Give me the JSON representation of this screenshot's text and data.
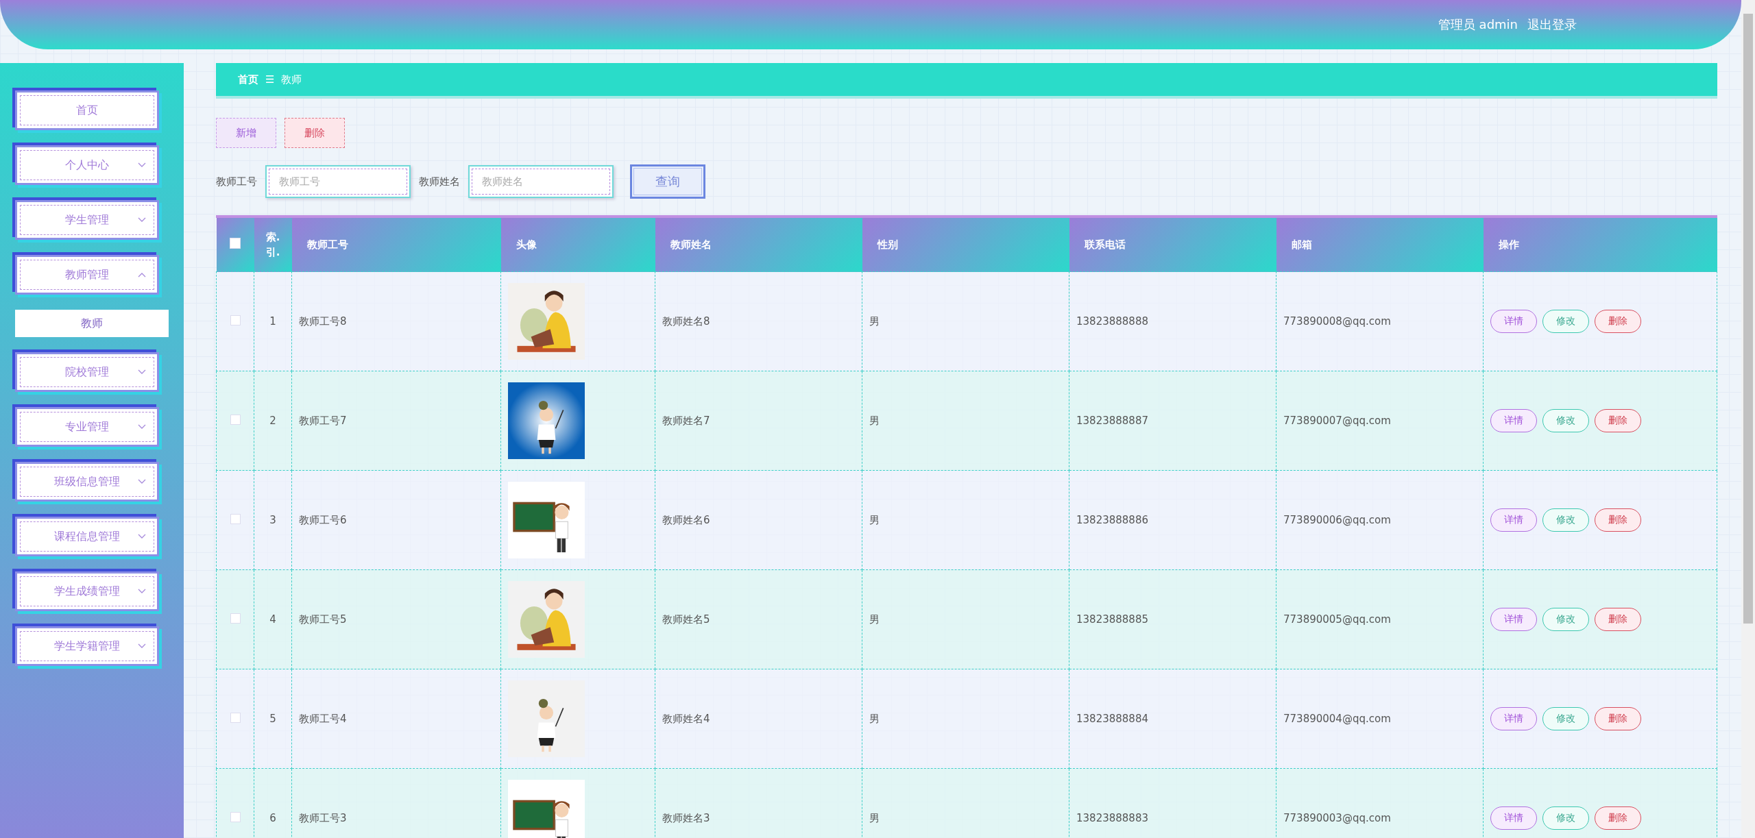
{
  "header": {
    "user_label": "管理员 admin",
    "logout": "退出登录"
  },
  "sidebar": {
    "items": [
      {
        "label": "首页",
        "kind": "link"
      },
      {
        "label": "个人中心",
        "kind": "menu",
        "expanded": false
      },
      {
        "label": "学生管理",
        "kind": "menu",
        "expanded": false
      },
      {
        "label": "教师管理",
        "kind": "menu",
        "expanded": true,
        "children": [
          {
            "label": "教师",
            "selected": true
          }
        ]
      },
      {
        "label": "院校管理",
        "kind": "menu",
        "expanded": false
      },
      {
        "label": "专业管理",
        "kind": "menu",
        "expanded": false
      },
      {
        "label": "班级信息管理",
        "kind": "menu",
        "expanded": false
      },
      {
        "label": "课程信息管理",
        "kind": "menu",
        "expanded": false
      },
      {
        "label": "学生成绩管理",
        "kind": "menu",
        "expanded": false
      },
      {
        "label": "学生学籍管理",
        "kind": "menu",
        "expanded": false
      }
    ]
  },
  "breadcrumb": {
    "items": [
      "首页",
      "教师"
    ],
    "separator": "☰"
  },
  "actions": [
    {
      "label": "新增",
      "kind": "add"
    },
    {
      "label": "删除",
      "kind": "delete"
    }
  ],
  "search": {
    "fields": [
      {
        "label": "教师工号",
        "placeholder": "教师工号"
      },
      {
        "label": "教师姓名",
        "placeholder": "教师姓名"
      }
    ],
    "button": "查询"
  },
  "table": {
    "select_all": false,
    "columns": [
      "索.引.",
      "教师工号",
      "头像",
      "教师姓名",
      "性别",
      "联系电话",
      "邮箱",
      "操作"
    ],
    "rows": [
      {
        "checked": false,
        "index": "1",
        "id": "教师工号8",
        "name": "教师姓名8",
        "gender": "男",
        "phone": "13823888888",
        "email": "773890008@qq.com",
        "actions": [
          {
            "label": "详情",
            "kind": "detail"
          },
          {
            "label": "修改",
            "kind": "edit"
          },
          {
            "label": "删除",
            "kind": "delete"
          }
        ]
      },
      {
        "checked": false,
        "index": "2",
        "id": "教师工号7",
        "name": "教师姓名7",
        "gender": "男",
        "phone": "13823888887",
        "email": "773890007@qq.com",
        "actions": [
          {
            "label": "详情",
            "kind": "detail"
          },
          {
            "label": "修改",
            "kind": "edit"
          },
          {
            "label": "删除",
            "kind": "delete"
          }
        ]
      },
      {
        "checked": false,
        "index": "3",
        "id": "教师工号6",
        "name": "教师姓名6",
        "gender": "男",
        "phone": "13823888886",
        "email": "773890006@qq.com",
        "actions": [
          {
            "label": "详情",
            "kind": "detail"
          },
          {
            "label": "修改",
            "kind": "edit"
          },
          {
            "label": "删除",
            "kind": "delete"
          }
        ]
      },
      {
        "checked": false,
        "index": "4",
        "id": "教师工号5",
        "name": "教师姓名5",
        "gender": "男",
        "phone": "13823888885",
        "email": "773890005@qq.com",
        "actions": [
          {
            "label": "详情",
            "kind": "detail"
          },
          {
            "label": "修改",
            "kind": "edit"
          },
          {
            "label": "删除",
            "kind": "delete"
          }
        ]
      },
      {
        "checked": false,
        "index": "5",
        "id": "教师工号4",
        "name": "教师姓名4",
        "gender": "男",
        "phone": "13823888884",
        "email": "773890004@qq.com",
        "actions": [
          {
            "label": "详情",
            "kind": "detail"
          },
          {
            "label": "修改",
            "kind": "edit"
          },
          {
            "label": "删除",
            "kind": "delete"
          }
        ]
      },
      {
        "checked": false,
        "index": "6",
        "id": "教师工号3",
        "name": "教师姓名3",
        "gender": "男",
        "phone": "13823888883",
        "email": "773890003@qq.com",
        "actions": [
          {
            "label": "详情",
            "kind": "detail"
          },
          {
            "label": "修改",
            "kind": "edit"
          },
          {
            "label": "删除",
            "kind": "delete"
          }
        ]
      }
    ]
  }
}
